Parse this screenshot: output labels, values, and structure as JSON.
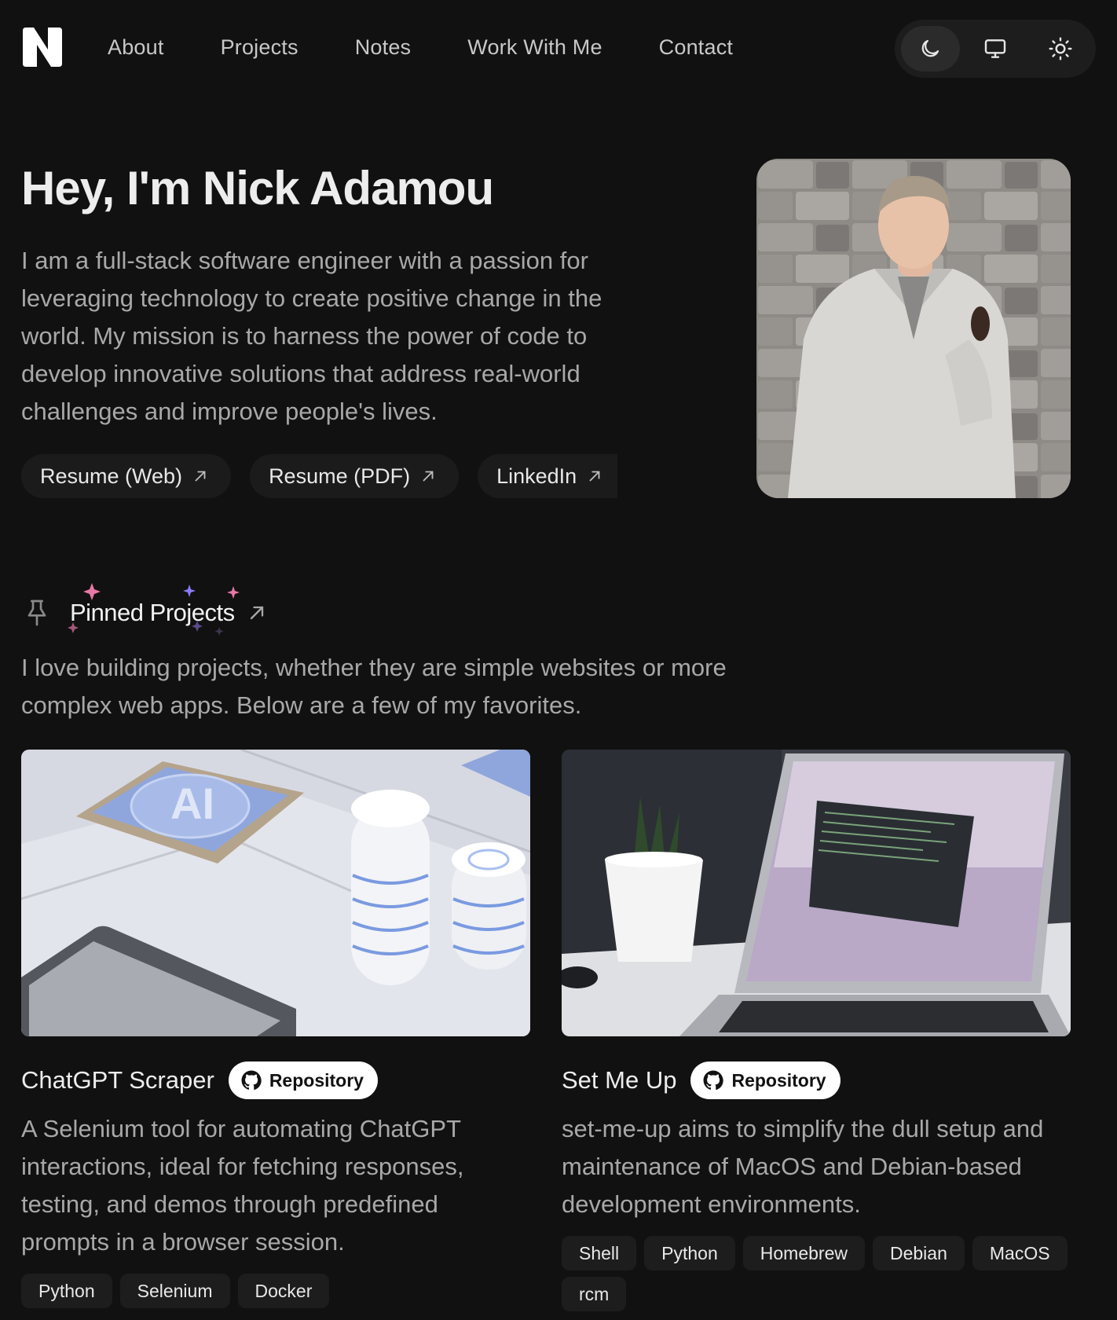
{
  "nav": {
    "items": [
      {
        "label": "About"
      },
      {
        "label": "Projects"
      },
      {
        "label": "Notes"
      },
      {
        "label": "Work With Me"
      },
      {
        "label": "Contact"
      }
    ],
    "theme_options": [
      "moon-icon",
      "monitor-icon",
      "sun-icon"
    ],
    "theme_selected": "dark"
  },
  "hero": {
    "title": "Hey, I'm Nick Adamou",
    "text": "I am a full-stack software engineer with a passion for leveraging technology to create positive change in the world. My mission is to harness the power of code to develop innovative solutions that address real-world challenges and improve people's lives.",
    "links": [
      {
        "label": "Resume (Web)"
      },
      {
        "label": "Resume (PDF)"
      },
      {
        "label": "LinkedIn"
      }
    ]
  },
  "pinned": {
    "title": "Pinned Projects",
    "text": "I love building projects, whether they are simple websites or more complex web apps. Below are a few of my favorites."
  },
  "projects": [
    {
      "title": "ChatGPT Scraper",
      "repo_label": "Repository",
      "description": "A Selenium tool for automating ChatGPT interactions, ideal for fetching responses, testing, and demos through predefined prompts in a browser session.",
      "tags": [
        "Python",
        "Selenium",
        "Docker"
      ]
    },
    {
      "title": "Set Me Up",
      "repo_label": "Repository",
      "description": "set-me-up aims to simplify the dull setup and maintenance of MacOS and Debian-based development environments.",
      "tags": [
        "Shell",
        "Python",
        "Homebrew",
        "Debian",
        "MacOS",
        "rcm"
      ]
    }
  ],
  "colors": {
    "background": "#111111",
    "text": "#ededed",
    "muted": "#a8a8a8",
    "sparkle_pink": "#e879a6",
    "sparkle_purple": "#8b7cf6"
  }
}
